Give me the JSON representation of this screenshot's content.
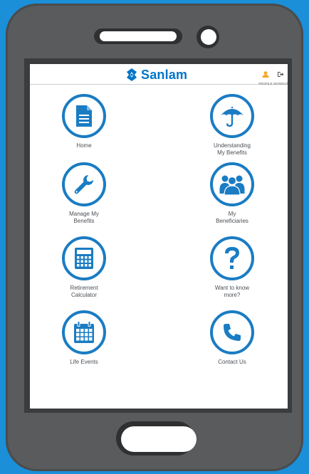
{
  "brand": {
    "name": "Sanlam",
    "color": "#0075c9"
  },
  "header": {
    "profile_label": "PROFILE",
    "signout_label": "SIGNOUT"
  },
  "tiles": [
    {
      "label_line1": "Home",
      "label_line2": "",
      "icon": "document-icon"
    },
    {
      "label_line1": "Understanding",
      "label_line2": "My Benefits",
      "icon": "umbrella-icon"
    },
    {
      "label_line1": "Manage My",
      "label_line2": "Benefits",
      "icon": "wrench-icon"
    },
    {
      "label_line1": "My",
      "label_line2": "Beneficiaries",
      "icon": "group-icon"
    },
    {
      "label_line1": "Retirement",
      "label_line2": "Calculator",
      "icon": "calculator-icon"
    },
    {
      "label_line1": "Want to know",
      "label_line2": "more?",
      "icon": "question-icon"
    },
    {
      "label_line1": "Life Events",
      "label_line2": "",
      "icon": "calendar-icon"
    },
    {
      "label_line1": "Contact Us",
      "label_line2": "",
      "icon": "phone-icon"
    }
  ],
  "colors": {
    "background": "#1b8fd8",
    "device": "#5a5b5d",
    "accent": "#1a7cc3",
    "profile_icon": "#f5a623"
  }
}
